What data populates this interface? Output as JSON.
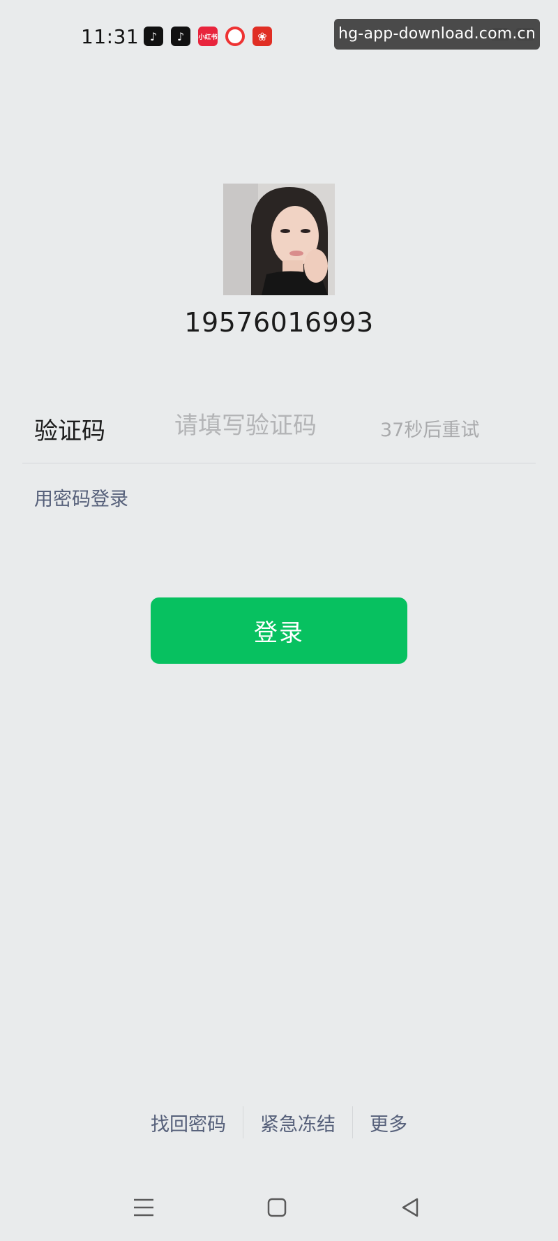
{
  "status_bar": {
    "time": "11:31",
    "app_icons": [
      "tiktok-icon",
      "tiktok-lite-icon",
      "xiaohongshu-icon",
      "circle-app-icon",
      "pinduoduo-icon"
    ],
    "xiaohongshu_text": "小红书"
  },
  "watermark": "hg-app-download.com.cn",
  "account": {
    "phone": "19576016993"
  },
  "verification": {
    "label": "验证码",
    "placeholder": "请填写验证码",
    "retry_text": "37秒后重试"
  },
  "password_login_link": "用密码登录",
  "login_button": "登录",
  "bottom_links": {
    "recover_password": "找回密码",
    "emergency_freeze": "紧急冻结",
    "more": "更多"
  },
  "colors": {
    "background": "#e9ebec",
    "primary_green": "#07c160",
    "link": "#56607a",
    "placeholder": "#b3b4b6"
  }
}
